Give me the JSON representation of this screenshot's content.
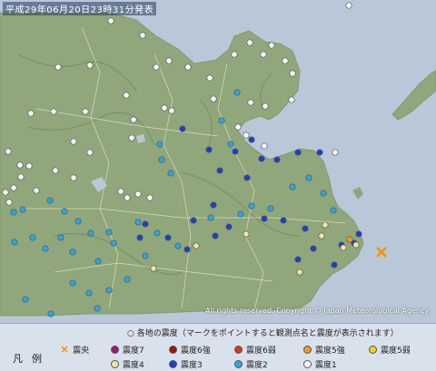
{
  "timestamp": "平成29年06月20日23時31分発表",
  "copyright": "All rights reserved. Copyright © Japan Meteorological Agency",
  "colors": {
    "sea": "#b8c8d8",
    "land": "#8fa77a",
    "ridge": "#6f8a5d",
    "border": "#e8e0c8",
    "epicenter": "#ff8c00"
  },
  "legend": {
    "header": "○ 各地の震度（マークをポイントすると観測点名と震度が表示されます）",
    "title": "凡例",
    "items": [
      {
        "label": "震央",
        "icon": "x-mark-icon",
        "color": "#ff8c00"
      },
      {
        "label": "震度7",
        "icon": "circle-icon",
        "color": "#9b1b6b"
      },
      {
        "label": "震度6強",
        "icon": "circle-icon",
        "color": "#a01010"
      },
      {
        "label": "震度6弱",
        "icon": "circle-icon",
        "color": "#e03020"
      },
      {
        "label": "震度5強",
        "icon": "circle-icon",
        "color": "#f59a20"
      },
      {
        "label": "震度5弱",
        "icon": "circle-icon",
        "color": "#f2d21a"
      },
      {
        "label": "震度4",
        "icon": "circle-icon",
        "color": "#f3e3a0"
      },
      {
        "label": "震度3",
        "icon": "circle-icon",
        "color": "#1a3fd0"
      },
      {
        "label": "震度2",
        "icon": "circle-icon",
        "color": "#2aa6e8"
      },
      {
        "label": "震度1",
        "icon": "circle-icon",
        "color": "#ffffff"
      }
    ]
  }
}
